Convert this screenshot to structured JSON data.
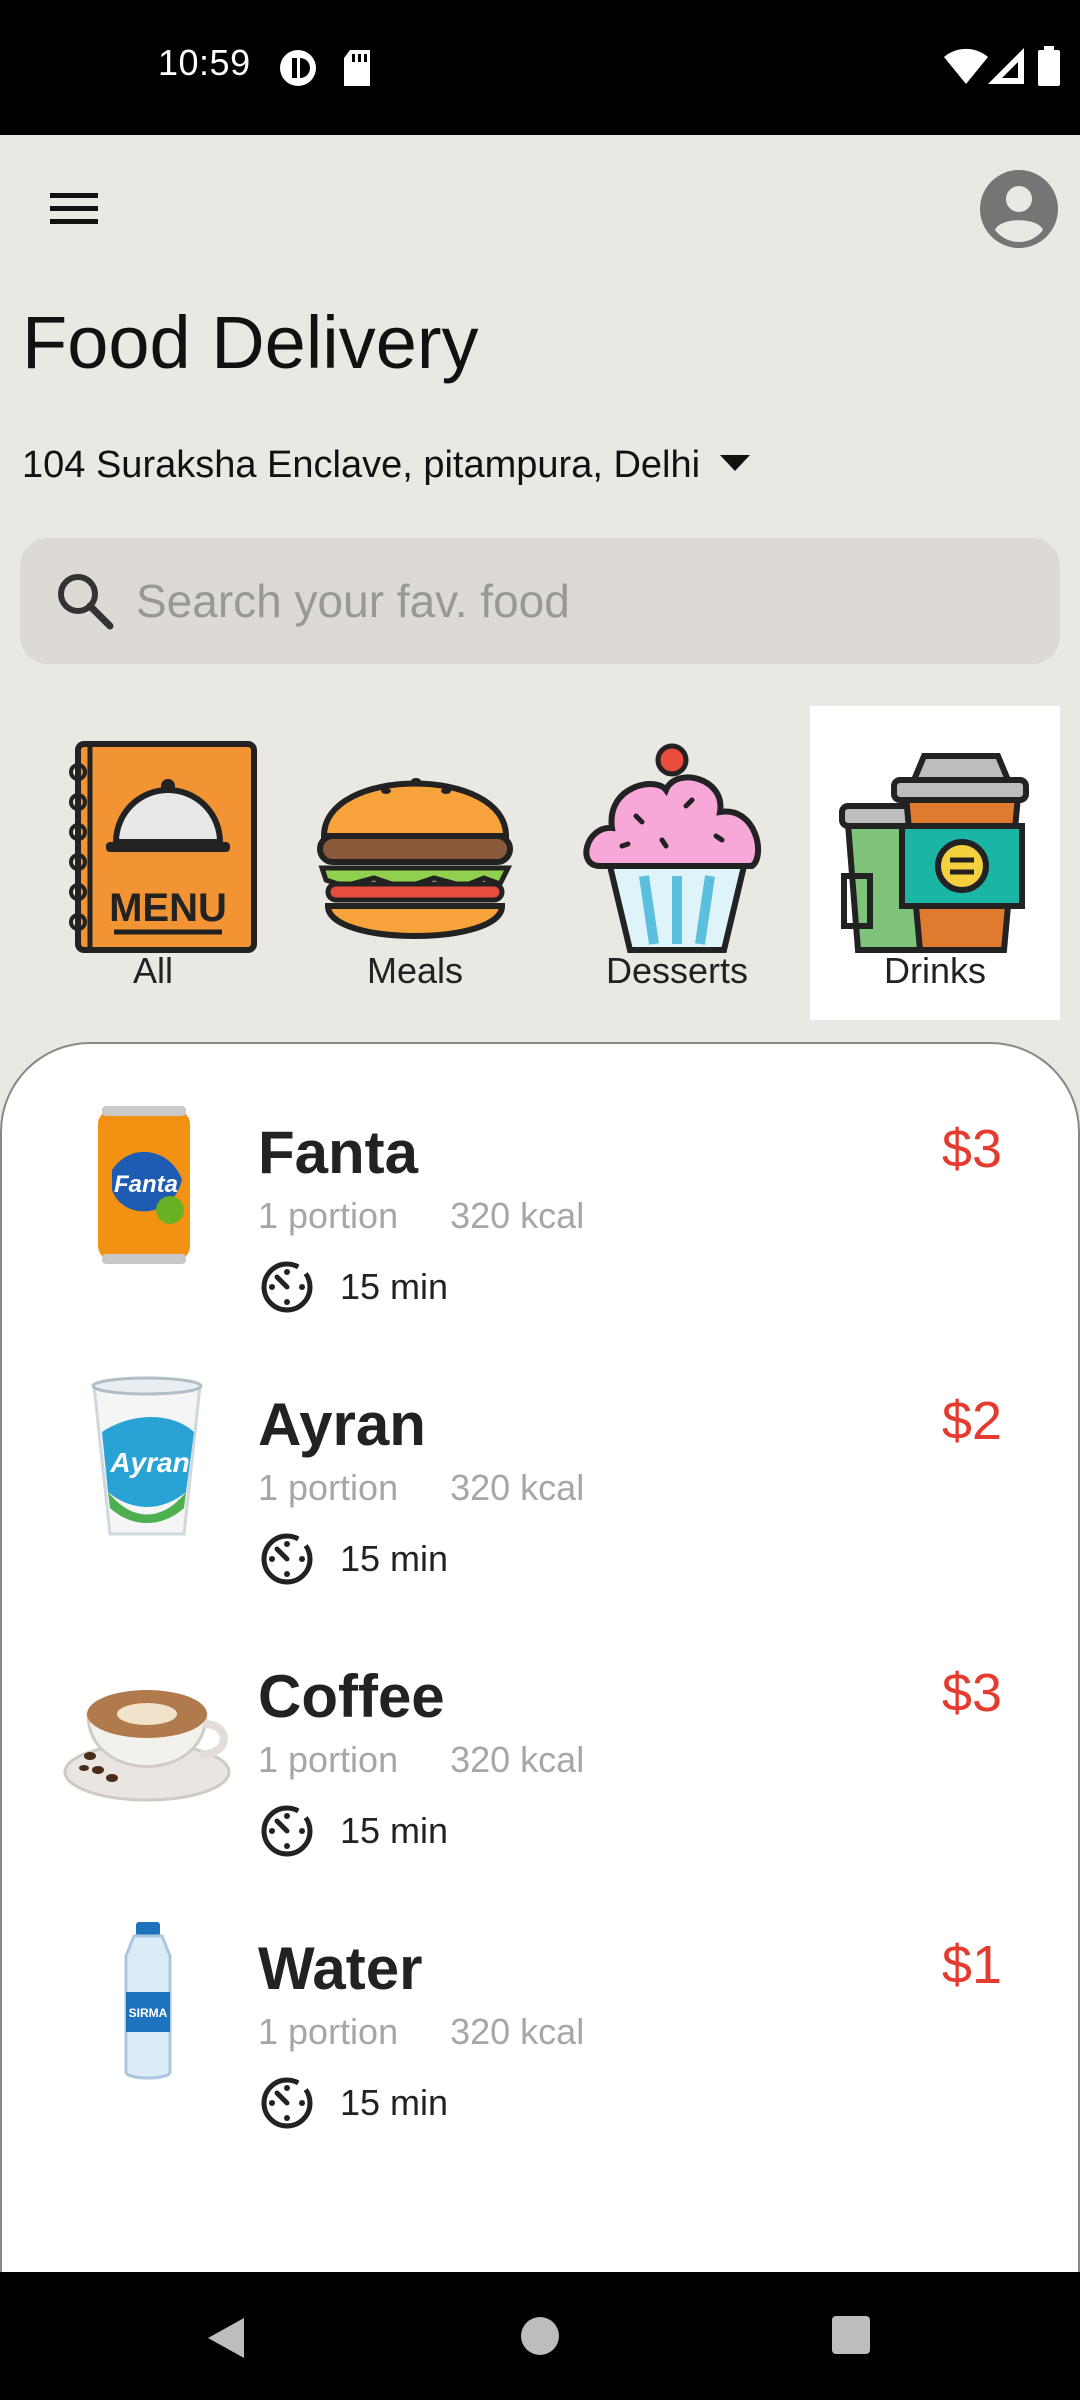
{
  "status_bar": {
    "time": "10:59"
  },
  "header": {
    "title": "Food Delivery",
    "address": "104 Suraksha Enclave, pitampura, Delhi"
  },
  "search": {
    "placeholder": "Search your fav. food"
  },
  "categories": [
    {
      "label": "All",
      "icon": "menu-book-icon"
    },
    {
      "label": "Meals",
      "icon": "burger-icon"
    },
    {
      "label": "Desserts",
      "icon": "cupcake-icon"
    },
    {
      "label": "Drinks",
      "icon": "coffee-cups-icon",
      "selected": true
    }
  ],
  "items": [
    {
      "name": "Fanta",
      "portion": "1 portion",
      "kcal": "320 kcal",
      "time": "15 min",
      "price": "$3",
      "image": "fanta-can-image"
    },
    {
      "name": "Ayran",
      "portion": "1 portion",
      "kcal": "320 kcal",
      "time": "15 min",
      "price": "$2",
      "image": "ayran-cup-image"
    },
    {
      "name": "Coffee",
      "portion": "1 portion",
      "kcal": "320 kcal",
      "time": "15 min",
      "price": "$3",
      "image": "coffee-cup-image"
    },
    {
      "name": "Water",
      "portion": "1 portion",
      "kcal": "320 kcal",
      "time": "15 min",
      "price": "$1",
      "image": "water-bottle-image"
    }
  ],
  "colors": {
    "background": "#eae8e2",
    "price": "#e53a2e",
    "selected_category_bg": "#ffffff"
  }
}
